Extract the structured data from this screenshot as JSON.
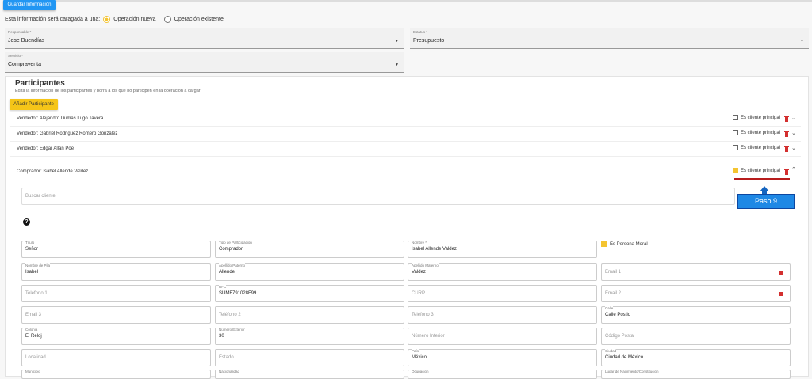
{
  "toolbar": {
    "save_label": "Guardar Información"
  },
  "operation": {
    "prompt": "Esta información será caragada a una:",
    "options": [
      {
        "label": "Operación nueva",
        "selected": true
      },
      {
        "label": "Operación existente",
        "selected": false
      }
    ]
  },
  "top_fields": {
    "responsable": {
      "label": "Responsable *",
      "value": "Jose Buendías"
    },
    "estatus": {
      "label": "Estatus *",
      "value": "Presupuesto"
    },
    "servicio": {
      "label": "Servicio *",
      "value": "Compraventa"
    }
  },
  "participants": {
    "title": "Participantes",
    "subtitle": "Edita la información de los participantes y borra a los que no participen en la operación a cargar",
    "add_label": "Añadir Participante",
    "checkbox_label": "Es cliente principal",
    "rows": [
      {
        "name": "Vendedor: Alejandro Dumas Lugo Tavera",
        "checked": false
      },
      {
        "name": "Vendedor: Gabriel Rodriguez Romero González",
        "checked": false
      },
      {
        "name": "Vendedor: Edgar Allan Poe",
        "checked": false
      }
    ],
    "expanded": {
      "name": "Comprador: Isabel Allende Valdez",
      "checked": true
    }
  },
  "search": {
    "placeholder": "Buscar cliente"
  },
  "annotation": {
    "step_label": "Paso 9",
    "accent": "#1e88e5"
  },
  "form": {
    "titulo": {
      "label": "Título",
      "value": "Señor"
    },
    "tipo_participacion": {
      "label": "Tipo de Participación",
      "value": "Comprador"
    },
    "nombre": {
      "label": "Nombre *",
      "value": "Isabel Allende Valdez"
    },
    "persona_moral": {
      "label": "Es Persona Moral",
      "checked": true
    },
    "nombre_pila": {
      "label": "Nombre de Pila",
      "value": "Isabel"
    },
    "apellido_paterno": {
      "label": "Apellido Paterno",
      "value": "Allende"
    },
    "apellido_materno": {
      "label": "Apellido Materno",
      "value": "Valdez"
    },
    "email1": {
      "placeholder": "Email 1"
    },
    "telefono1": {
      "placeholder": "Teléfono 1"
    },
    "rfc": {
      "label": "RFC",
      "value": "SUMF791028F99"
    },
    "curp": {
      "placeholder": "CURP"
    },
    "email2": {
      "placeholder": "Email 2"
    },
    "email3": {
      "placeholder": "Email 3"
    },
    "telefono2": {
      "placeholder": "Teléfono 2"
    },
    "telefono3": {
      "placeholder": "Teléfono 3"
    },
    "calle": {
      "label": "Calle",
      "value": "Calle Postio"
    },
    "colonia": {
      "label": "Colonia",
      "value": "El Reloj"
    },
    "numero_exterior": {
      "label": "Número Exterior",
      "value": "30"
    },
    "numero_interior": {
      "placeholder": "Número Interior"
    },
    "codigo_postal": {
      "placeholder": "Código Postal"
    },
    "localidad": {
      "placeholder": "Localidad"
    },
    "estado": {
      "placeholder": "Estado"
    },
    "pais": {
      "label": "País",
      "value": "México"
    },
    "ciudad": {
      "label": "Ciudad",
      "value": "Ciudad de México"
    },
    "municipio": {
      "label": "Municipio"
    },
    "nacionalidad": {
      "label": "Nacionalidad"
    },
    "ocupacion": {
      "label": "Ocupación"
    },
    "lugar_nacimiento": {
      "label": "Lugar de Nacimiento/Constitución"
    }
  }
}
